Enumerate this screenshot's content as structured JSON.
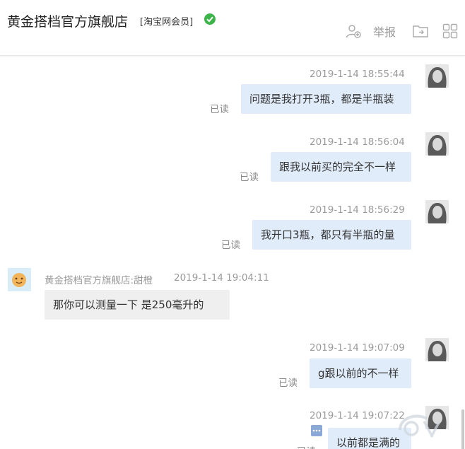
{
  "header": {
    "shop_name": "黄金搭档官方旗舰店",
    "member_tag": "[淘宝网会员]",
    "report_label": "举报"
  },
  "messages": [
    {
      "time": "2019-1-14 18:55:44",
      "text": "问题是我打开3瓶，都是半瓶装",
      "status": "已读"
    },
    {
      "time": "2019-1-14 18:56:04",
      "text": "跟我以前买的完全不一样",
      "status": "已读"
    },
    {
      "time": "2019-1-14 18:56:29",
      "text": "我开口3瓶，都只有半瓶的量",
      "status": "已读"
    },
    {
      "sender": "黄金搭档官方旗舰店:甜橙",
      "time": "2019-1-14 19:04:11",
      "text": "那你可以测量一下  是250毫升的"
    },
    {
      "time": "2019-1-14 19:07:09",
      "text": "g跟以前的不一样",
      "status": "已读"
    },
    {
      "time": "2019-1-14 19:07:22",
      "text": "以前都是满的",
      "status": "已读"
    }
  ],
  "colors": {
    "outgoing_bubble": "#e0ecfa",
    "incoming_bubble": "#efefef",
    "verified": "#3cb44a"
  }
}
